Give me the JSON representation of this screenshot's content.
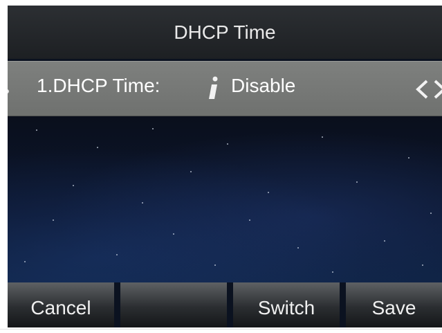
{
  "header": {
    "title": "DHCP Time"
  },
  "field": {
    "label": "1.DHCP Time:",
    "value": "Disable",
    "info_icon": "info-icon",
    "left_icon": "chevron-left-icon",
    "right_icon": "chevron-right-icon"
  },
  "softkeys": [
    {
      "label": "Cancel"
    },
    {
      "label": ""
    },
    {
      "label": "Switch"
    },
    {
      "label": "Save"
    }
  ],
  "colors": {
    "title_bar": "#24272a",
    "field_row": "#777977",
    "text": "#ffffff"
  }
}
